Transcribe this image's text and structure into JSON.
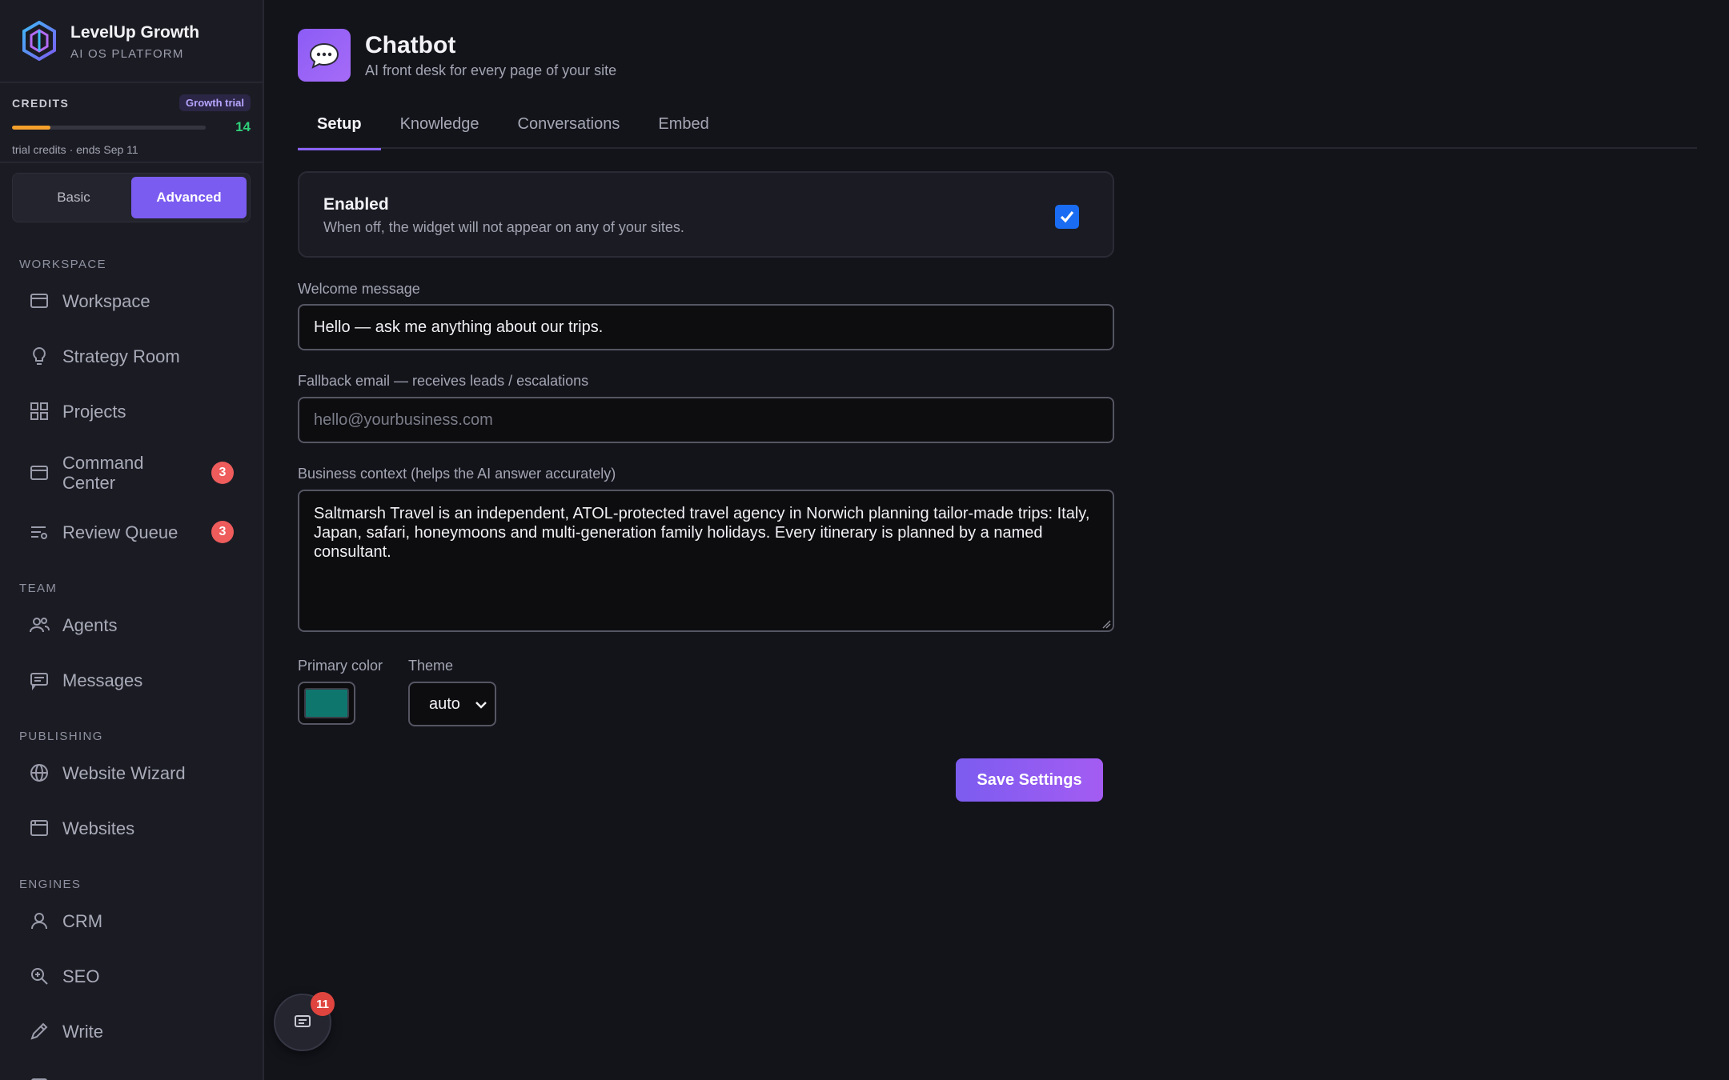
{
  "brand": {
    "name": "LevelUp Growth",
    "subtitle": "AI OS PLATFORM"
  },
  "credits": {
    "label": "CREDITS",
    "plan_badge": "Growth trial",
    "remaining": "14",
    "progress_fraction": 0.2,
    "note": "trial credits · ends Sep 11"
  },
  "mode_toggle": {
    "basic": "Basic",
    "advanced": "Advanced",
    "selected": "Advanced"
  },
  "sidebar": {
    "sections": [
      {
        "title": "WORKSPACE",
        "items": [
          {
            "label": "Workspace",
            "icon": "workspace-icon"
          },
          {
            "label": "Strategy Room",
            "icon": "lightbulb-icon"
          },
          {
            "label": "Projects",
            "icon": "grid-icon"
          },
          {
            "label": "Command Center",
            "icon": "command-center-icon",
            "badge": "3"
          },
          {
            "label": "Review Queue",
            "icon": "review-queue-icon",
            "badge": "3"
          }
        ]
      },
      {
        "title": "TEAM",
        "items": [
          {
            "label": "Agents",
            "icon": "users-icon"
          },
          {
            "label": "Messages",
            "icon": "messages-icon"
          }
        ]
      },
      {
        "title": "PUBLISHING",
        "items": [
          {
            "label": "Website Wizard",
            "icon": "globe-icon"
          },
          {
            "label": "Websites",
            "icon": "browser-icon"
          }
        ]
      },
      {
        "title": "ENGINES",
        "items": [
          {
            "label": "CRM",
            "icon": "user-icon"
          },
          {
            "label": "SEO",
            "icon": "seo-search-icon"
          },
          {
            "label": "Write",
            "icon": "pencil-icon"
          }
        ]
      }
    ]
  },
  "header": {
    "title": "Chatbot",
    "subtitle": "AI front desk for every page of your site",
    "icon": "chat-bubble-icon"
  },
  "tabs": [
    {
      "label": "Setup",
      "active": true
    },
    {
      "label": "Knowledge",
      "active": false
    },
    {
      "label": "Conversations",
      "active": false
    },
    {
      "label": "Embed",
      "active": false
    }
  ],
  "enabled": {
    "title": "Enabled",
    "description": "When off, the widget will not appear on any of your sites.",
    "checked": true
  },
  "form": {
    "welcome_label": "Welcome message",
    "welcome_value": "Hello — ask me anything about our trips.",
    "fallback_label": "Fallback email — receives leads / escalations",
    "fallback_value": "",
    "fallback_placeholder": "hello@yourbusiness.com",
    "context_label": "Business context (helps the AI answer accurately)",
    "context_value": "Saltmarsh Travel is an independent, ATOL-protected travel agency in Norwich planning tailor-made trips: Italy, Japan, safari, honeymoons and multi-generation family holidays. Every itinerary is planned by a named consultant.",
    "primary_color_label": "Primary color",
    "primary_color_value": "#0f766e",
    "theme_label": "Theme",
    "theme_value": "auto"
  },
  "save_button": "Save Settings",
  "chat_fab": {
    "badge": "11"
  },
  "colors": {
    "accent": "#7b5cf0",
    "badge_red": "#ee5c5c",
    "credits_green": "#2fcf7a",
    "credits_orange": "#f3a12b"
  }
}
